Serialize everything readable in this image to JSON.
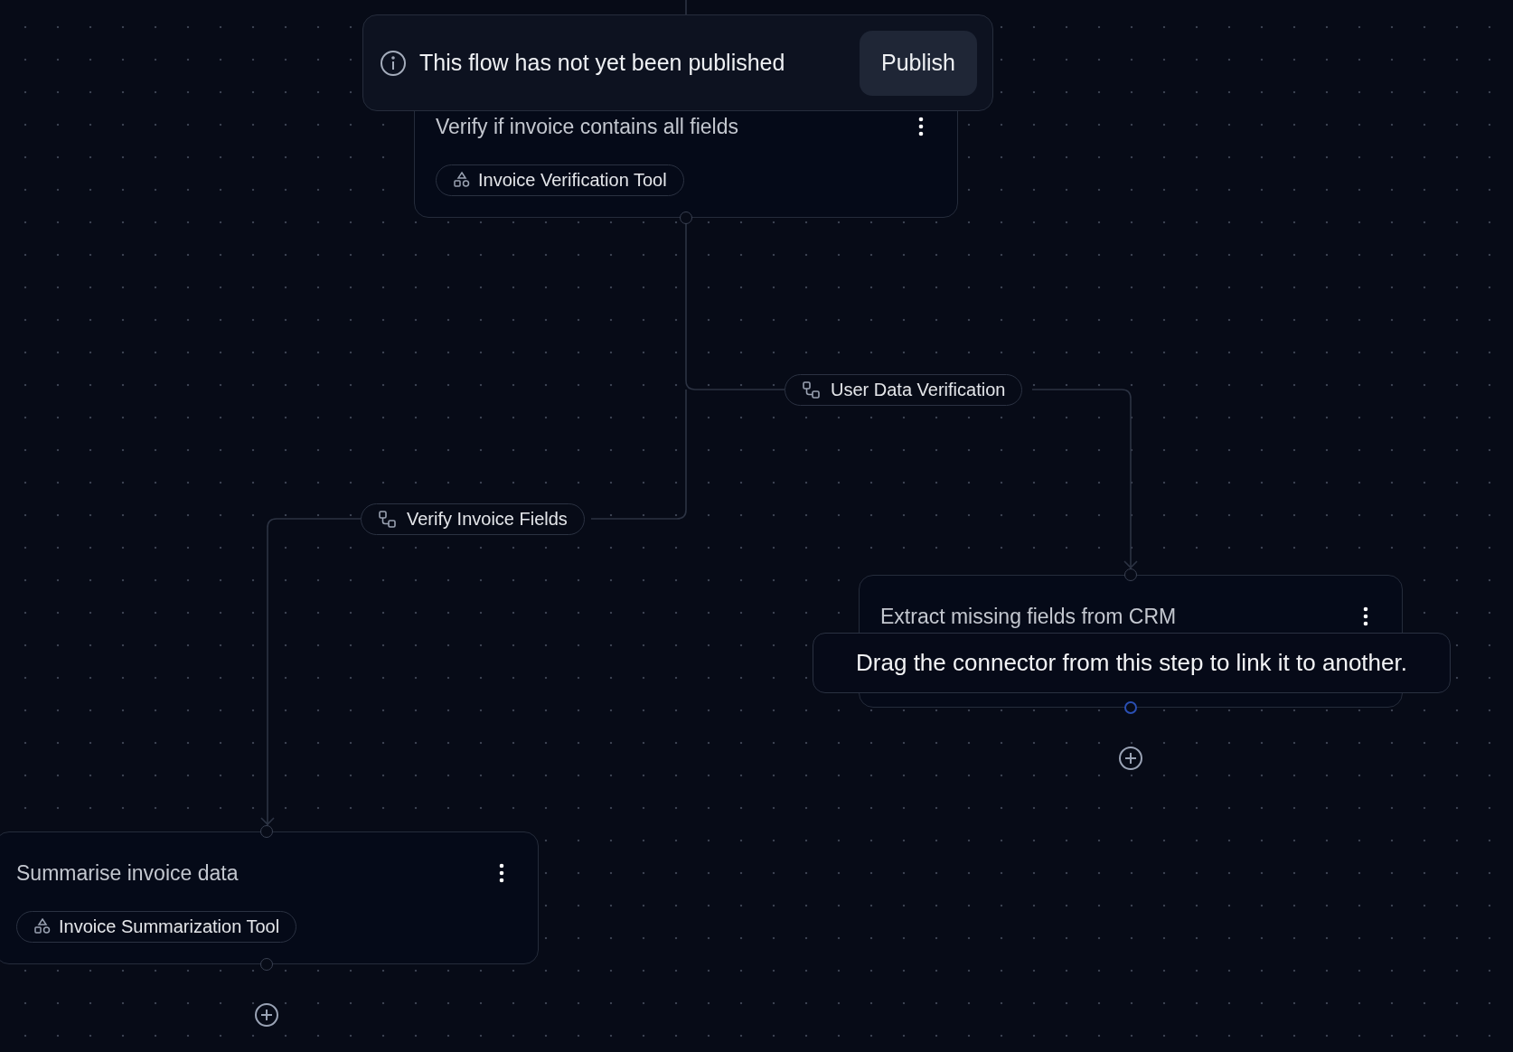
{
  "banner": {
    "message": "This flow has not yet been published",
    "button": "Publish"
  },
  "nodes": [
    {
      "title": "Verify if invoice contains all fields",
      "tool": "Invoice Verification Tool",
      "handle_active": false
    },
    {
      "title": "Extract missing fields from CRM",
      "handle_active": true,
      "add_button": true
    },
    {
      "title": "Summarise invoice data",
      "tool": "Invoice Summarization Tool",
      "handle_active": false,
      "add_button": true
    }
  ],
  "edge_labels": [
    {
      "label": "User Data Verification"
    },
    {
      "label": "Verify Invoice Fields"
    }
  ],
  "tooltip": {
    "text": "Drag the connector from this step to link it to another."
  }
}
